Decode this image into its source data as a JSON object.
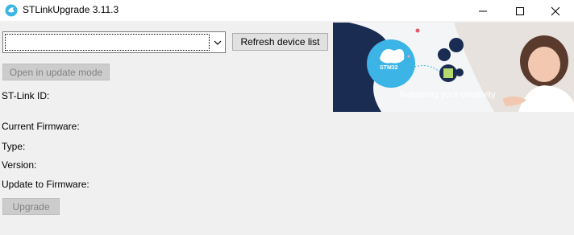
{
  "window": {
    "title": "STLinkUpgrade 3.11.3",
    "minimize_icon": "minimize-icon",
    "maximize_icon": "maximize-icon",
    "close_icon": "close-icon"
  },
  "device_select": {
    "value": ""
  },
  "buttons": {
    "refresh": "Refresh device list",
    "open_update": "Open in update mode",
    "upgrade": "Upgrade"
  },
  "labels": {
    "stlink_id": "ST-Link ID:",
    "current_firmware": "Current Firmware:",
    "type": "Type:",
    "version": "Version:",
    "update_to": "Update to Firmware:"
  },
  "banner": {
    "tagline": "Releasing your creativity",
    "logo_text": "STM32"
  },
  "colors": {
    "st_blue": "#03234b",
    "st_cyan": "#3cb4e6",
    "disabled_text": "#838383"
  }
}
